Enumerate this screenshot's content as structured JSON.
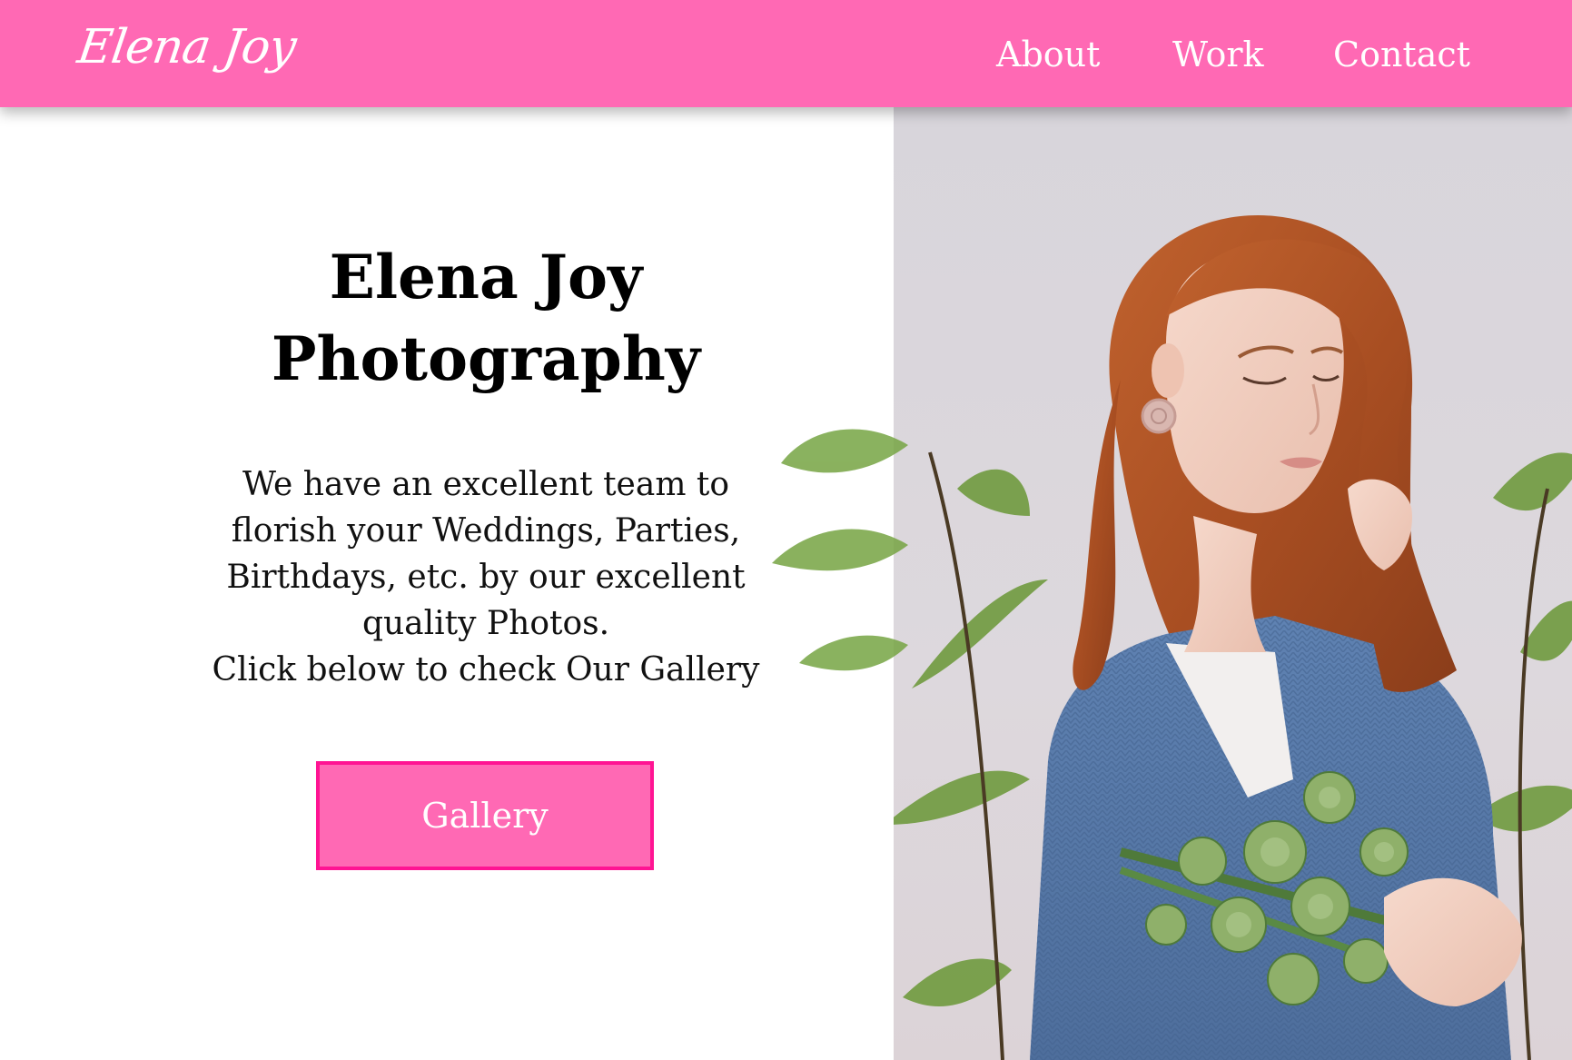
{
  "brand": {
    "logo_text": "Elena Joy"
  },
  "nav": {
    "items": [
      "About",
      "Work",
      "Contact"
    ]
  },
  "hero": {
    "title_line1": "Elena Joy",
    "title_line2": "Photography",
    "desc_line1": "We have an excellent team to",
    "desc_line2": "florish your Weddings, Parties,",
    "desc_line3": "Birthdays, etc. by our excellent",
    "desc_line4": "quality Photos.",
    "desc_line5": "Click below to check Our Gallery",
    "button_label": "Gallery"
  },
  "colors": {
    "navbar": "#ff69b4",
    "button_fill": "#ff69b4",
    "button_border": "#ff1493",
    "text_light": "#ffffff",
    "text_dark": "#000000"
  },
  "icons": {
    "photo": "woman-holding-flowers-photo"
  }
}
